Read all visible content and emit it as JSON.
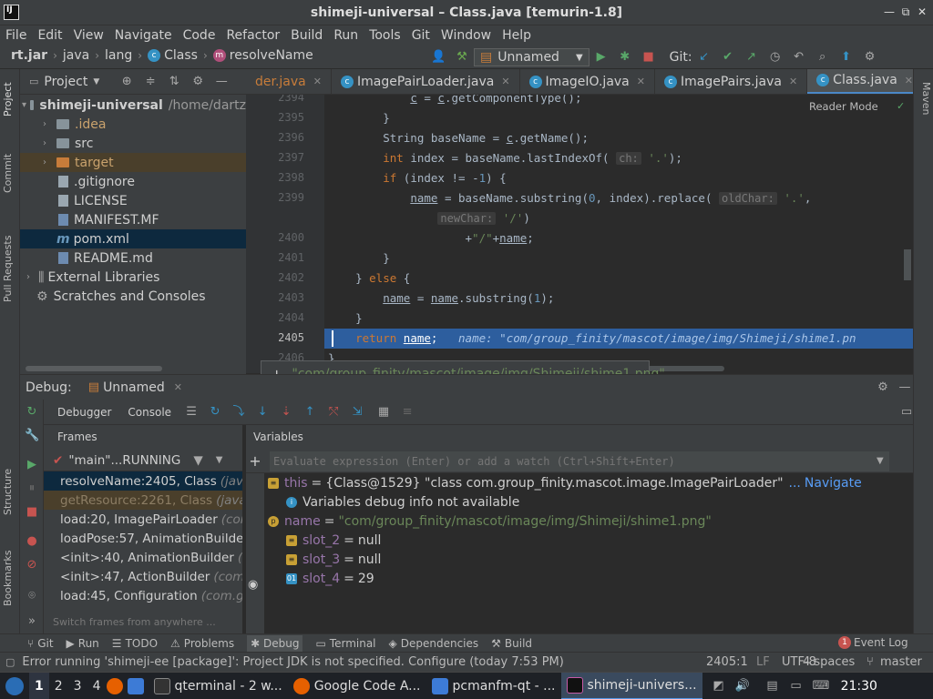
{
  "window": {
    "title": "shimeji-universal – Class.java [temurin-1.8]"
  },
  "menu": [
    "File",
    "Edit",
    "View",
    "Navigate",
    "Code",
    "Refactor",
    "Build",
    "Run",
    "Tools",
    "Git",
    "Window",
    "Help"
  ],
  "breadcrumb": {
    "items": [
      "rt.jar",
      "java",
      "lang",
      "Class",
      "resolveName"
    ]
  },
  "run_config": {
    "label": "Unnamed",
    "git_label": "Git:"
  },
  "left_strip": {
    "project": "Project",
    "commit": "Commit",
    "pull_requests": "Pull Requests",
    "structure": "Structure",
    "bookmarks": "Bookmarks"
  },
  "right_strip": {
    "maven": "Maven"
  },
  "project_panel": {
    "title": "Project",
    "root": {
      "name": "shimeji-universal",
      "path": "/home/dartz"
    },
    "items": [
      {
        "label": ".idea",
        "type": "folder"
      },
      {
        "label": "src",
        "type": "folder"
      },
      {
        "label": "target",
        "type": "folder-orange"
      },
      {
        "label": ".gitignore",
        "type": "file"
      },
      {
        "label": "LICENSE",
        "type": "file"
      },
      {
        "label": "MANIFEST.MF",
        "type": "file"
      },
      {
        "label": "pom.xml",
        "type": "maven"
      },
      {
        "label": "README.md",
        "type": "file"
      }
    ],
    "external": "External Libraries",
    "scratches": "Scratches and Consoles"
  },
  "editor_tabs": [
    {
      "label": "der.java",
      "active": false
    },
    {
      "label": "ImagePairLoader.java",
      "active": false
    },
    {
      "label": "ImageIO.java",
      "active": false
    },
    {
      "label": "ImagePairs.java",
      "active": false
    },
    {
      "label": "Class.java",
      "active": true
    }
  ],
  "editor": {
    "reader_mode": "Reader Mode",
    "line_numbers": [
      "2394",
      "2395",
      "2396",
      "2397",
      "2398",
      "2399",
      "",
      "2400",
      "2401",
      "2402",
      "2403",
      "2404",
      "2405",
      "2406"
    ],
    "exec_line_value": "name: \"com/group_finity/mascot/image/img/Shimeji/shime1.pn"
  },
  "tooltip": {
    "value": "\"com/group_finity/mascot/image/img/Shimeji/shime1.png\""
  },
  "debug": {
    "title": "Debug:",
    "config": "Unnamed",
    "tabs": [
      "Debugger",
      "Console"
    ],
    "frames_label": "Frames",
    "variables_label": "Variables",
    "thread": "\"main\"...RUNNING",
    "frames": [
      {
        "method": "resolveName:2405, Class",
        "cls": "(java",
        "selected": true
      },
      {
        "method": "getResource:2261, Class",
        "cls": "(java",
        "dim": true
      },
      {
        "method": "load:20, ImagePairLoader",
        "cls": "(com"
      },
      {
        "method": "loadPose:57, AnimationBuilder",
        "cls": ""
      },
      {
        "method": "<init>:40, AnimationBuilder",
        "cls": "(c"
      },
      {
        "method": "<init>:47, ActionBuilder",
        "cls": "(com."
      },
      {
        "method": "load:45, Configuration",
        "cls": "(com.gr"
      }
    ],
    "switch_frames": "Switch frames from anywhere ...",
    "eval_placeholder": "Evaluate expression (Enter) or add a watch (Ctrl+Shift+Enter)",
    "variables": [
      {
        "name": "this",
        "value": "{Class@1529} \"class com.group_finity.mascot.image.ImagePairLoader\"",
        "link": "Navigate",
        "expand": true
      },
      {
        "name": "",
        "value": "Variables debug info not available",
        "info": true
      },
      {
        "name": "name",
        "value": "\"com/group_finity/mascot/image/img/Shimeji/shime1.png\"",
        "expand": true,
        "string": true
      },
      {
        "name": "slot_2",
        "value": "null"
      },
      {
        "name": "slot_3",
        "value": "null"
      },
      {
        "name": "slot_4",
        "value": "29"
      }
    ]
  },
  "tool_windows": [
    "Git",
    "Run",
    "TODO",
    "Problems",
    "Debug",
    "Terminal",
    "Dependencies",
    "Build"
  ],
  "event_log": {
    "count": "1",
    "label": "Event Log"
  },
  "status": {
    "message": "Error running 'shimeji-ee [package]': Project JDK is not specified. Configure (today 7:53 PM)",
    "position": "2405:1",
    "line_sep": "LF",
    "encoding": "UTF-8",
    "indent": "4 spaces",
    "branch": "master"
  },
  "taskbar": {
    "workspaces": [
      "1",
      "2",
      "3",
      "4"
    ],
    "items": [
      {
        "label": "qterminal - 2 w...",
        "icon": "terminal"
      },
      {
        "label": "Google Code A...",
        "icon": "firefox"
      },
      {
        "label": "pcmanfm-qt - ...",
        "icon": "folder"
      },
      {
        "label": "shimeji-univers...",
        "icon": "intellij",
        "active": true
      }
    ],
    "clock": "21:30"
  },
  "colors": {
    "accent": "#4a88c7",
    "exec_line": "#2d5e9e",
    "keyword": "#cc7832",
    "string": "#6a8759",
    "field": "#9876aa"
  }
}
